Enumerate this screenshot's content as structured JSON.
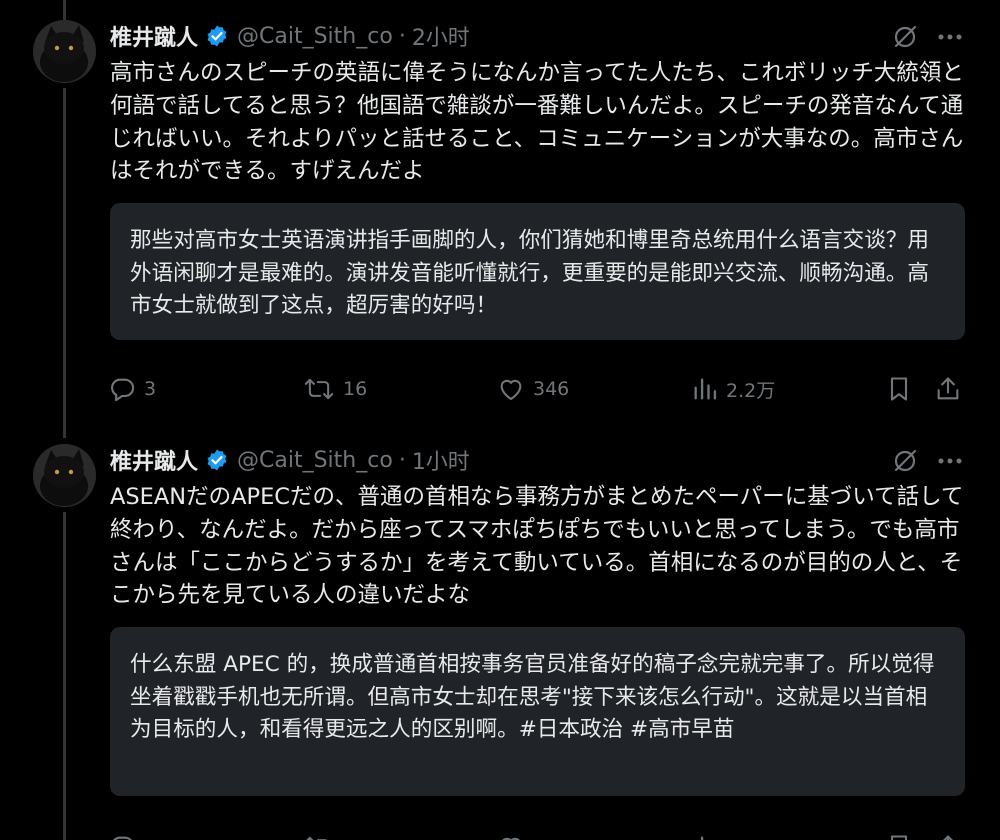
{
  "tweets": [
    {
      "author": "椎井蹴人",
      "handle": "@Cait_Sith_co",
      "separator": "·",
      "time": "2小时",
      "text": "高市さんのスピーチの英語に偉そうになんか言ってた人たち、これボリッチ大統領と何語で話してると思う？他国語で雑談が一番難しいんだよ。スピーチの発音なんて通じればいい。それよりパッと話せること、コミュニケーションが大事なの。高市さんはそれができる。すげえんだよ",
      "translation": "那些对高市女士英语演讲指手画脚的人，你们猜她和博里奇总统用什么语言交谈？用外语闲聊才是最难的。演讲发音能听懂就行，更重要的是能即兴交流、顺畅沟通。高市女士就做到了这点，超厉害的好吗！",
      "stats": {
        "replies": "3",
        "reposts": "16",
        "likes": "346",
        "views": "2.2万"
      }
    },
    {
      "author": "椎井蹴人",
      "handle": "@Cait_Sith_co",
      "separator": "·",
      "time": "1小时",
      "text": "ASEANだのAPECだの、普通の首相なら事務方がまとめたペーパーに基づいて話して終わり、なんだよ。だから座ってスマホぽちぽちでもいいと思ってしまう。でも高市さんは「ここからどうするか」を考えて動いている。首相になるのが目的の人と、そこから先を見ている人の違いだよな",
      "translation": "什么东盟 APEC 的，换成普通首相按事务官员准备好的稿子念完就完事了。所以觉得坐着戳戳手机也无所谓。但高市女士却在思考\"接下来该怎么行动\"。这就是以当首相为目标的人，和看得更远之人的区别啊。#日本政治 #高市早苗"
    }
  ],
  "colors": {
    "background": "#000000",
    "text": "#e7e9ea",
    "muted": "#71767b",
    "verified": "#1d9bf0",
    "translation_bg": "#202327",
    "thread_line": "#333639"
  },
  "icons": [
    "verified-badge-icon",
    "grok-icon",
    "more-icon",
    "reply-icon",
    "repost-icon",
    "like-icon",
    "views-icon",
    "bookmark-icon",
    "share-icon"
  ]
}
